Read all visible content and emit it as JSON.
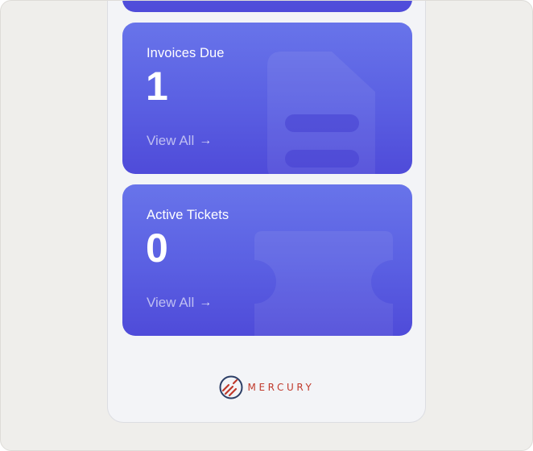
{
  "cards": [
    {
      "title": "Invoices Due",
      "count": "1",
      "link_label": "View All",
      "link_icon": "arrow-right-icon"
    },
    {
      "title": "Active Tickets",
      "count": "0",
      "link_label": "View All",
      "link_icon": "arrow-right-icon"
    }
  ],
  "brand": {
    "name": "MERCURY",
    "logo_icon": "mercury-logo-icon"
  },
  "colors": {
    "card_gradient_top": "#6874ea",
    "card_gradient_bottom": "#4f4bd9",
    "brand_red": "#c0392b",
    "brand_navy": "#2c3e66",
    "page_background": "#efeeeb",
    "phone_background": "#f3f4f7"
  }
}
